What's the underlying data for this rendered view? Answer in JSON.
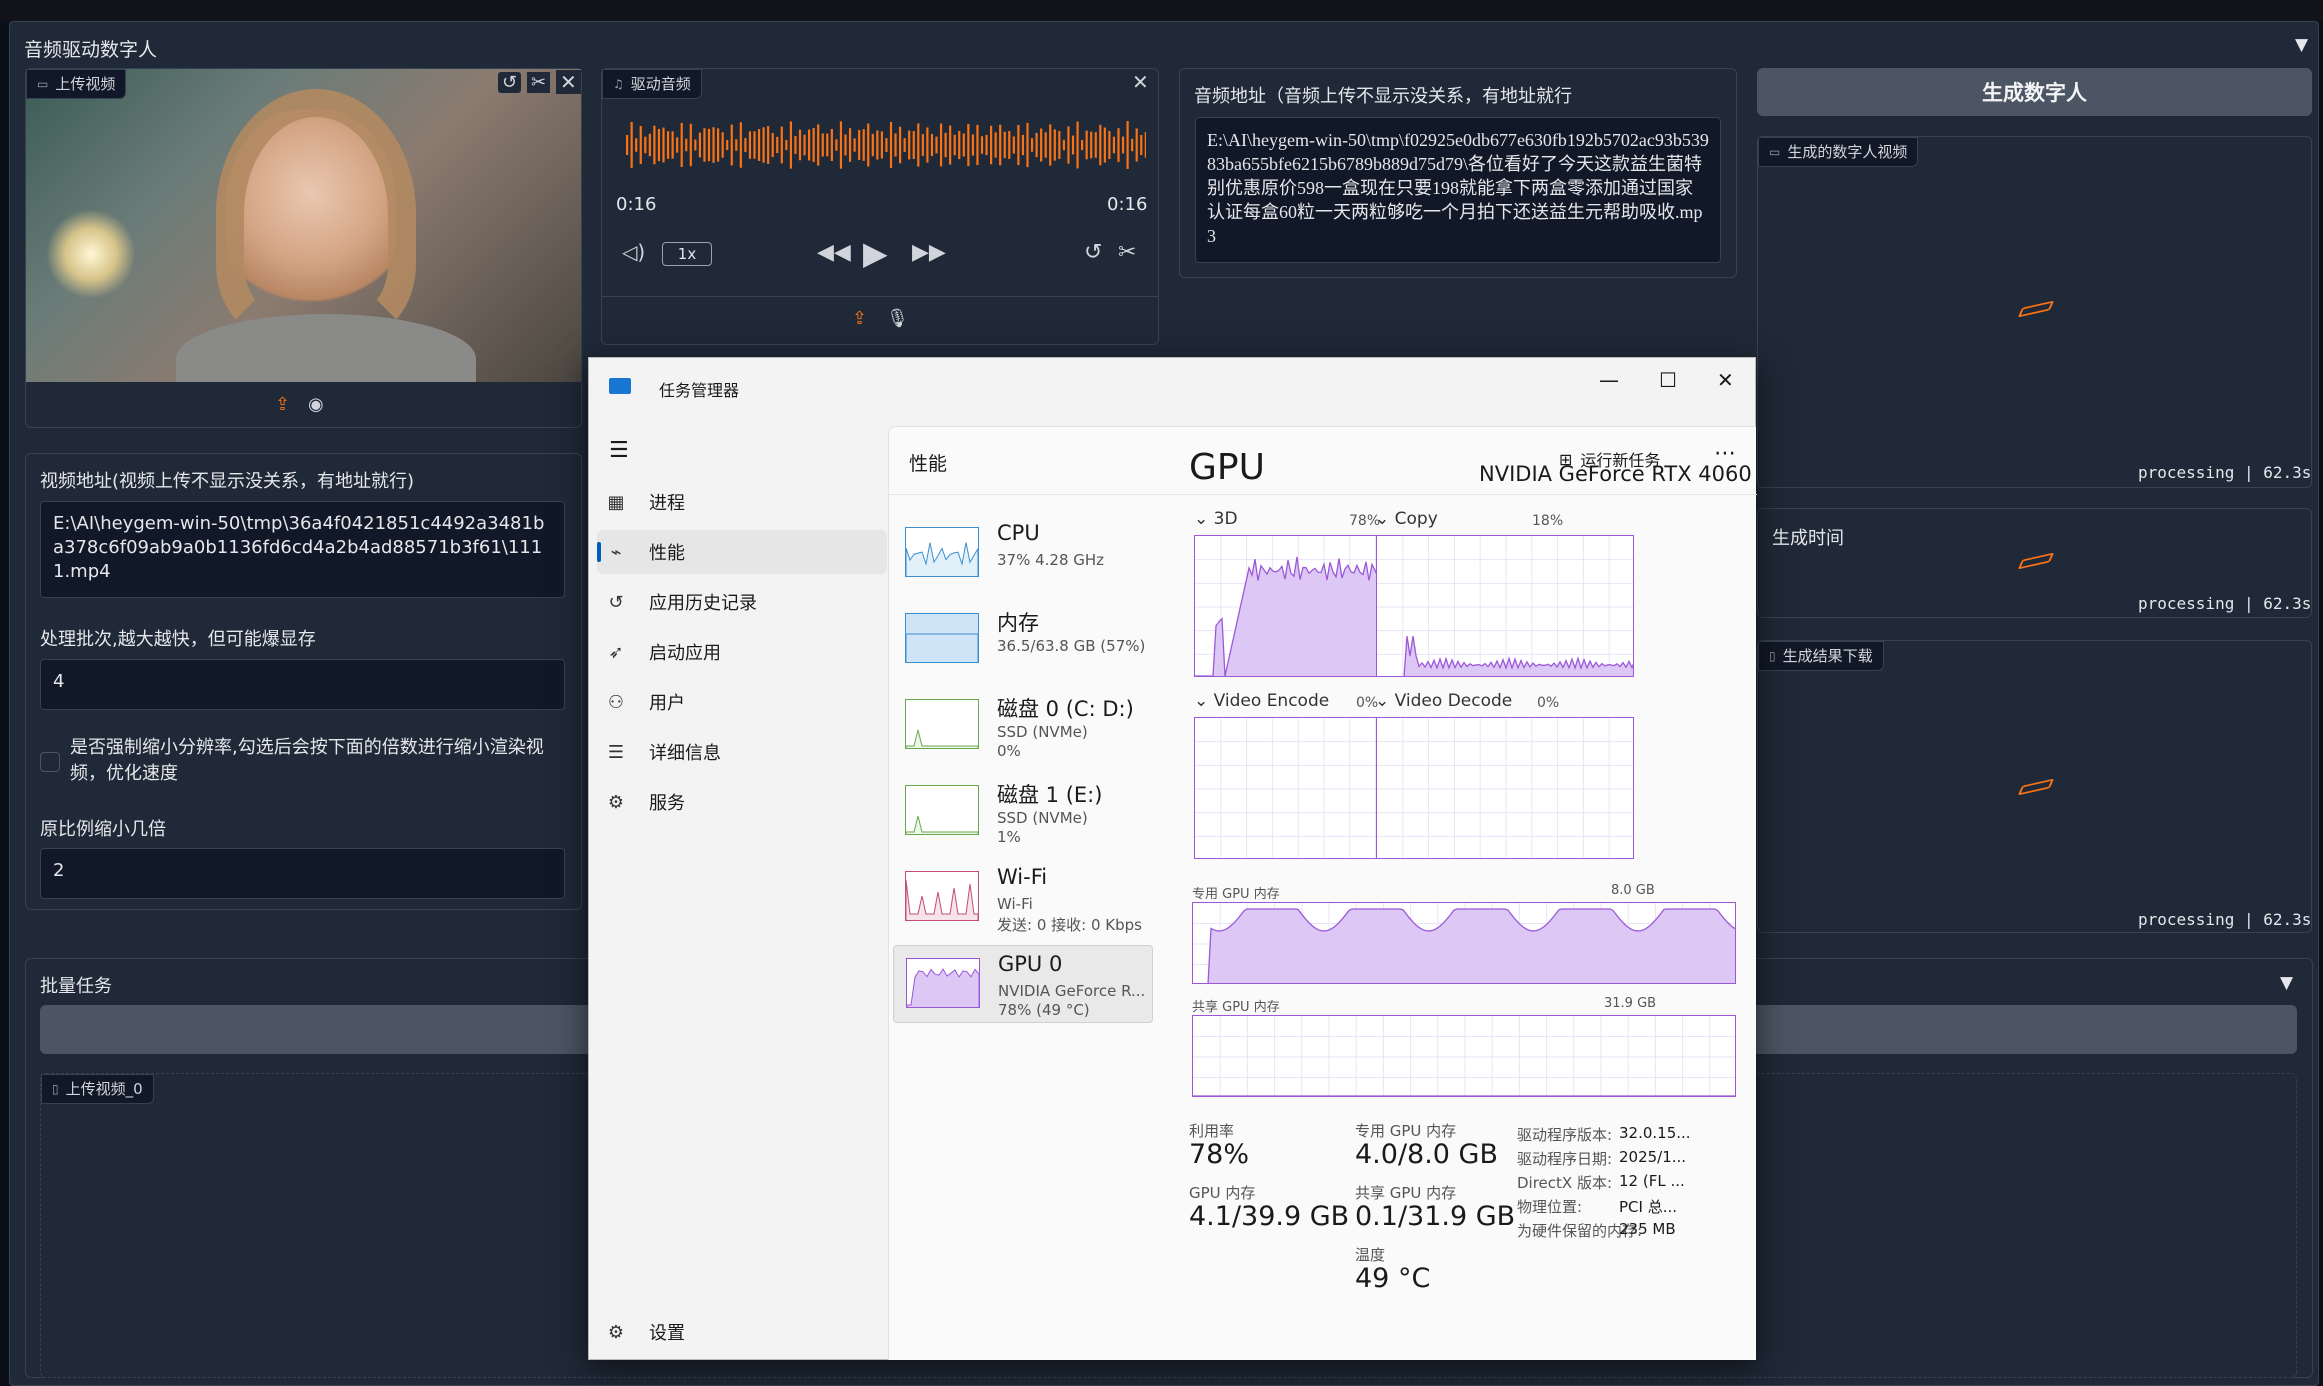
{
  "app": {
    "title": "音频驱动数字人",
    "video": {
      "label": "上传视频",
      "url_label": "视频地址(视频上传不显示没关系，有地址就行)",
      "url_value": "E:\\AI\\heygem-win-50\\tmp\\36a4f0421851c4492a3481ba378c6f09ab9a0b1136fd6cd4a2b4ad88571b3f61\\1111.mp4"
    },
    "audio": {
      "label": "驱动音频",
      "time_current": "0:16",
      "time_total": "0:16",
      "speed": "1x"
    },
    "audio_url": {
      "label": "音频地址（音频上传不显示没关系，有地址就行",
      "value": "E:\\AI\\heygem-win-50\\tmp\\f02925e0db677e630fb192b5702ac93b53983ba655bfe6215b6789b889d75d79\\各位看好了今天这款益生菌特别优惠原价598一盒现在只要198就能拿下两盒零添加通过国家认证每盒60粒一天两粒够吃一个月拍下还送益生元帮助吸收.mp3"
    },
    "batch_size": {
      "label": "处理批次,越大越快，但可能爆显存",
      "value": "4"
    },
    "force_scale": {
      "label": "是否强制缩小分辨率,勾选后会按下面的倍数进行缩小渲染视频，优化速度",
      "checked": false
    },
    "scale": {
      "label": "原比例缩小几倍",
      "value": "2"
    },
    "generate_button": "生成数字人",
    "output_video": {
      "label": "生成的数字人视频",
      "status": "processing | 62.3s"
    },
    "gen_time": {
      "label": "生成时间",
      "status": "processing | 62.3s"
    },
    "download": {
      "label": "生成结果下载",
      "status": "processing | 62.3s"
    },
    "batch": {
      "title": "批量任务",
      "file_label": "上传视频_0"
    }
  },
  "taskmgr": {
    "title": "任务管理器",
    "nav": [
      {
        "icon": "processes-icon",
        "glyph": "▦",
        "label": "进程"
      },
      {
        "icon": "performance-icon",
        "glyph": "⌁",
        "label": "性能",
        "selected": true
      },
      {
        "icon": "history-icon",
        "glyph": "↺",
        "label": "应用历史记录"
      },
      {
        "icon": "startup-icon",
        "glyph": "➶",
        "label": "启动应用"
      },
      {
        "icon": "users-icon",
        "glyph": "⚇",
        "label": "用户"
      },
      {
        "icon": "details-icon",
        "glyph": "☰",
        "label": "详细信息"
      },
      {
        "icon": "services-icon",
        "glyph": "⚙",
        "label": "服务"
      }
    ],
    "settings": "设置",
    "page_title": "性能",
    "run_task": "运行新任务",
    "devices": [
      {
        "name": "CPU",
        "sub1": "37% 4.28 GHz",
        "sub2": "",
        "sub3": ""
      },
      {
        "name": "内存",
        "sub1": "36.5/63.8 GB (57%)",
        "sub2": "",
        "sub3": ""
      },
      {
        "name": "磁盘 0 (C: D:)",
        "sub1": "SSD (NVMe)",
        "sub2": "0%",
        "sub3": ""
      },
      {
        "name": "磁盘 1 (E:)",
        "sub1": "SSD (NVMe)",
        "sub2": "1%",
        "sub3": ""
      },
      {
        "name": "Wi-Fi",
        "sub1": "Wi-Fi",
        "sub2": "发送: 0 接收: 0 Kbps",
        "sub3": ""
      },
      {
        "name": "GPU 0",
        "sub1": "NVIDIA GeForce R...",
        "sub2": "78% (49 °C)",
        "sub3": "",
        "selected": true
      }
    ],
    "gpu": {
      "heading": "GPU",
      "model": "NVIDIA GeForce RTX 4060",
      "engines": [
        {
          "name": "3D",
          "pct": "78%"
        },
        {
          "name": "Copy",
          "pct": "18%"
        },
        {
          "name": "Video Encode",
          "pct": "0%"
        },
        {
          "name": "Video Decode",
          "pct": "0%"
        }
      ],
      "dedicated_label": "专用 GPU 内存",
      "dedicated_max": "8.0 GB",
      "shared_label": "共享 GPU 内存",
      "shared_max": "31.9 GB",
      "stats": {
        "util_label": "利用率",
        "util": "78%",
        "ded_label": "专用 GPU 内存",
        "ded": "4.0/8.0 GB",
        "gpumem_label": "GPU 内存",
        "gpumem": "4.1/39.9 GB",
        "shared_label": "共享 GPU 内存",
        "shared": "0.1/31.9 GB",
        "temp_label": "温度",
        "temp": "49 °C"
      },
      "info": [
        {
          "k": "驱动程序版本:",
          "v": "32.0.15..."
        },
        {
          "k": "驱动程序日期:",
          "v": "2025/1..."
        },
        {
          "k": "DirectX 版本:",
          "v": "12 (FL ..."
        },
        {
          "k": "物理位置:",
          "v": "PCI 总..."
        },
        {
          "k": "为硬件保留的内存:",
          "v": "235 MB"
        }
      ]
    }
  },
  "colors": {
    "accent": "#f97316",
    "graph_purple": "#9b59d9",
    "graph_fill": "#dcc7f5"
  }
}
